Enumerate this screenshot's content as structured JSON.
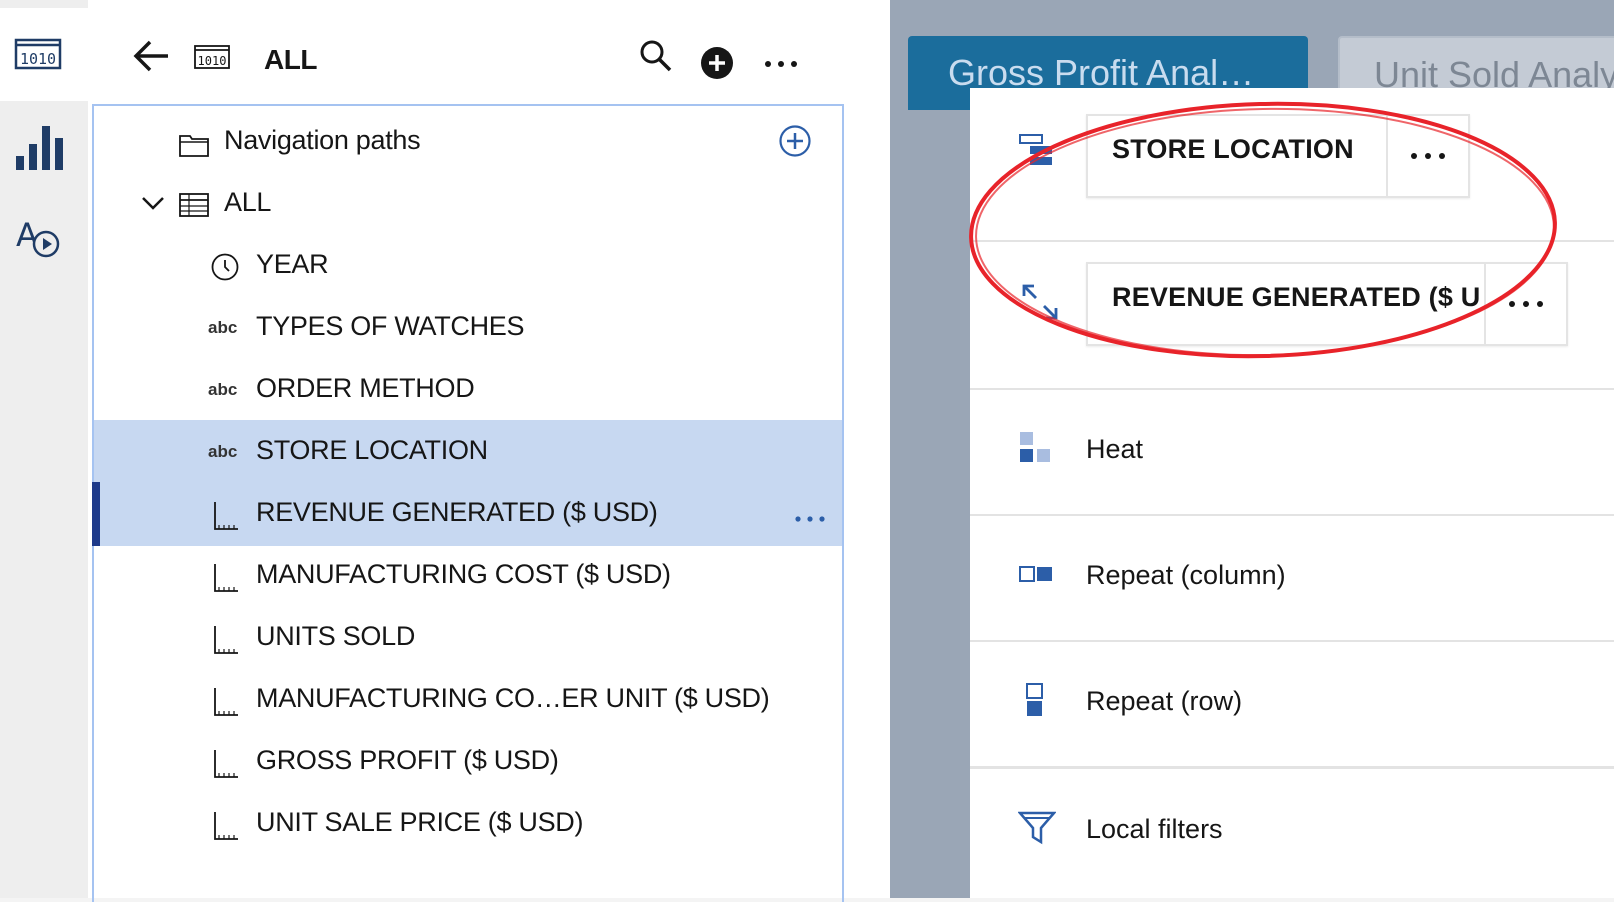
{
  "panel": {
    "header": {
      "title": "ALL"
    },
    "tree": {
      "nav_paths_label": "Navigation paths",
      "group_label": "ALL",
      "items": [
        {
          "label": "YEAR",
          "type": "date"
        },
        {
          "label": "TYPES OF WATCHES",
          "type": "abc",
          "type_label": "abc"
        },
        {
          "label": "ORDER METHOD",
          "type": "abc",
          "type_label": "abc"
        },
        {
          "label": "STORE LOCATION",
          "type": "abc",
          "type_label": "abc",
          "selected": true
        },
        {
          "label": "REVENUE GENERATED ($ USD)",
          "type": "measure",
          "selected": true
        },
        {
          "label": "MANUFACTURING COST ($ USD)",
          "type": "measure"
        },
        {
          "label": "UNITS SOLD",
          "type": "measure"
        },
        {
          "label": "MANUFACTURING CO…ER UNIT ($ USD)",
          "type": "measure"
        },
        {
          "label": "GROSS PROFIT ($ USD)",
          "type": "measure"
        },
        {
          "label": "UNIT SALE PRICE ($ USD)",
          "type": "measure"
        }
      ]
    }
  },
  "tabs": [
    {
      "label": "Gross Profit Anal…",
      "active": true
    },
    {
      "label": "Unit Sold Analy"
    }
  ],
  "fields": {
    "pill1": "STORE LOCATION",
    "pill2": "REVENUE GENERATED ($ U",
    "options": [
      "Heat",
      "Repeat (column)",
      "Repeat (row)",
      "Local filters"
    ]
  },
  "colors": {
    "accent": "#1b6d9c",
    "selection": "#c7d8f1",
    "icon": "#1f3c66",
    "annotation": "#e8232a"
  }
}
